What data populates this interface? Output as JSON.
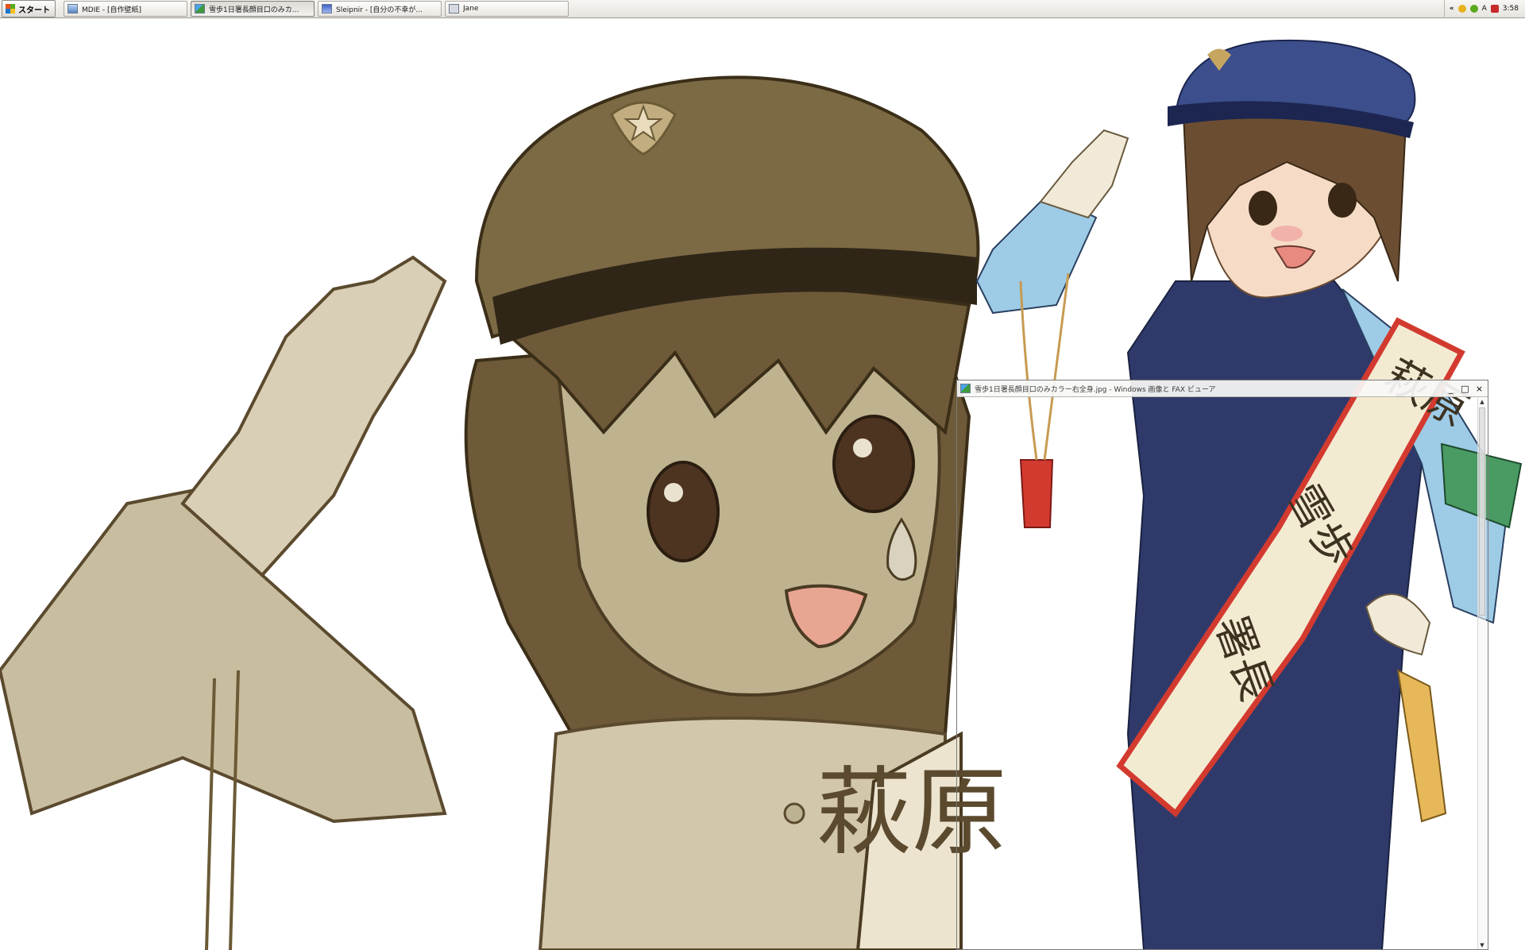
{
  "taskbar": {
    "start_label": "スタート",
    "buttons": [
      {
        "label": "MDIE - [自作壁紙]",
        "icon": "ie-icon"
      },
      {
        "label": "雪歩1日署長顔目口のみカ...",
        "icon": "image-viewer-icon"
      },
      {
        "label": "Sleipnir - [自分の不幸が...",
        "icon": "sleipnir-icon"
      },
      {
        "label": "Jane",
        "icon": "jane-icon"
      }
    ],
    "tray": {
      "expand": "«",
      "ime": "A",
      "clock": "3:58"
    }
  },
  "viewer": {
    "title": "雪歩1日署長顔目口のみカラー右全身.jpg - Windows 画像と FAX ビューア",
    "minimize": "_",
    "maximize": "□",
    "close": "×"
  },
  "wallpaper": {
    "sash_text_large": "萩原",
    "sash_text_figure": [
      "萩原",
      "雪歩",
      "署長"
    ]
  },
  "colors": {
    "sepia_base": "#b6a989",
    "sepia_dark": "#5b4a2e",
    "hat_navy": "#3c4e8c",
    "uniform_blue": "#9ecbe6",
    "vest_navy": "#2f3a6b",
    "sash_red": "#d33a2f"
  }
}
